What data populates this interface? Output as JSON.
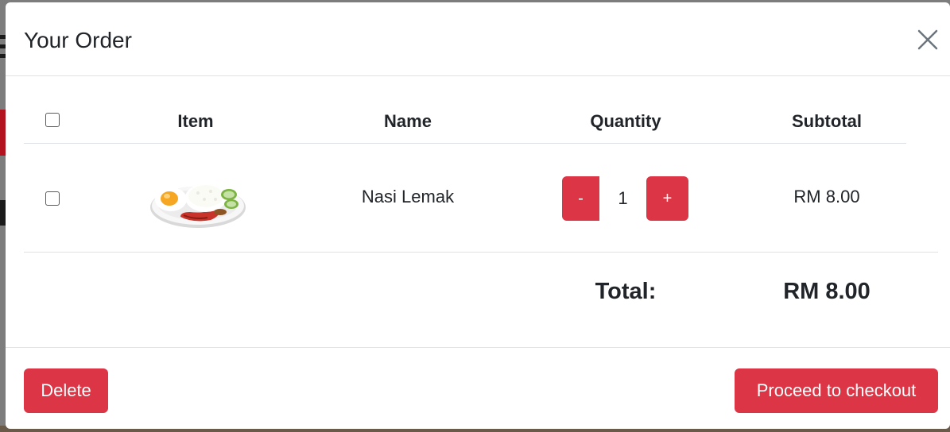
{
  "modal": {
    "title": "Your Order"
  },
  "table": {
    "headers": {
      "item": "Item",
      "name": "Name",
      "quantity": "Quantity",
      "subtotal": "Subtotal"
    },
    "rows": [
      {
        "checked": false,
        "image_icon": "nasi-lemak-plate",
        "name": "Nasi Lemak",
        "quantity": "1",
        "subtotal": "RM 8.00"
      }
    ],
    "quantity_controls": {
      "decrement_label": "-",
      "increment_label": "+"
    }
  },
  "total": {
    "label": "Total:",
    "value": "RM 8.00"
  },
  "footer": {
    "delete_label": "Delete",
    "checkout_label": "Proceed to checkout"
  },
  "colors": {
    "accent": "#dc3545",
    "text": "#212529",
    "divider": "#dee2e6",
    "backdrop": "#7d7d7d"
  }
}
